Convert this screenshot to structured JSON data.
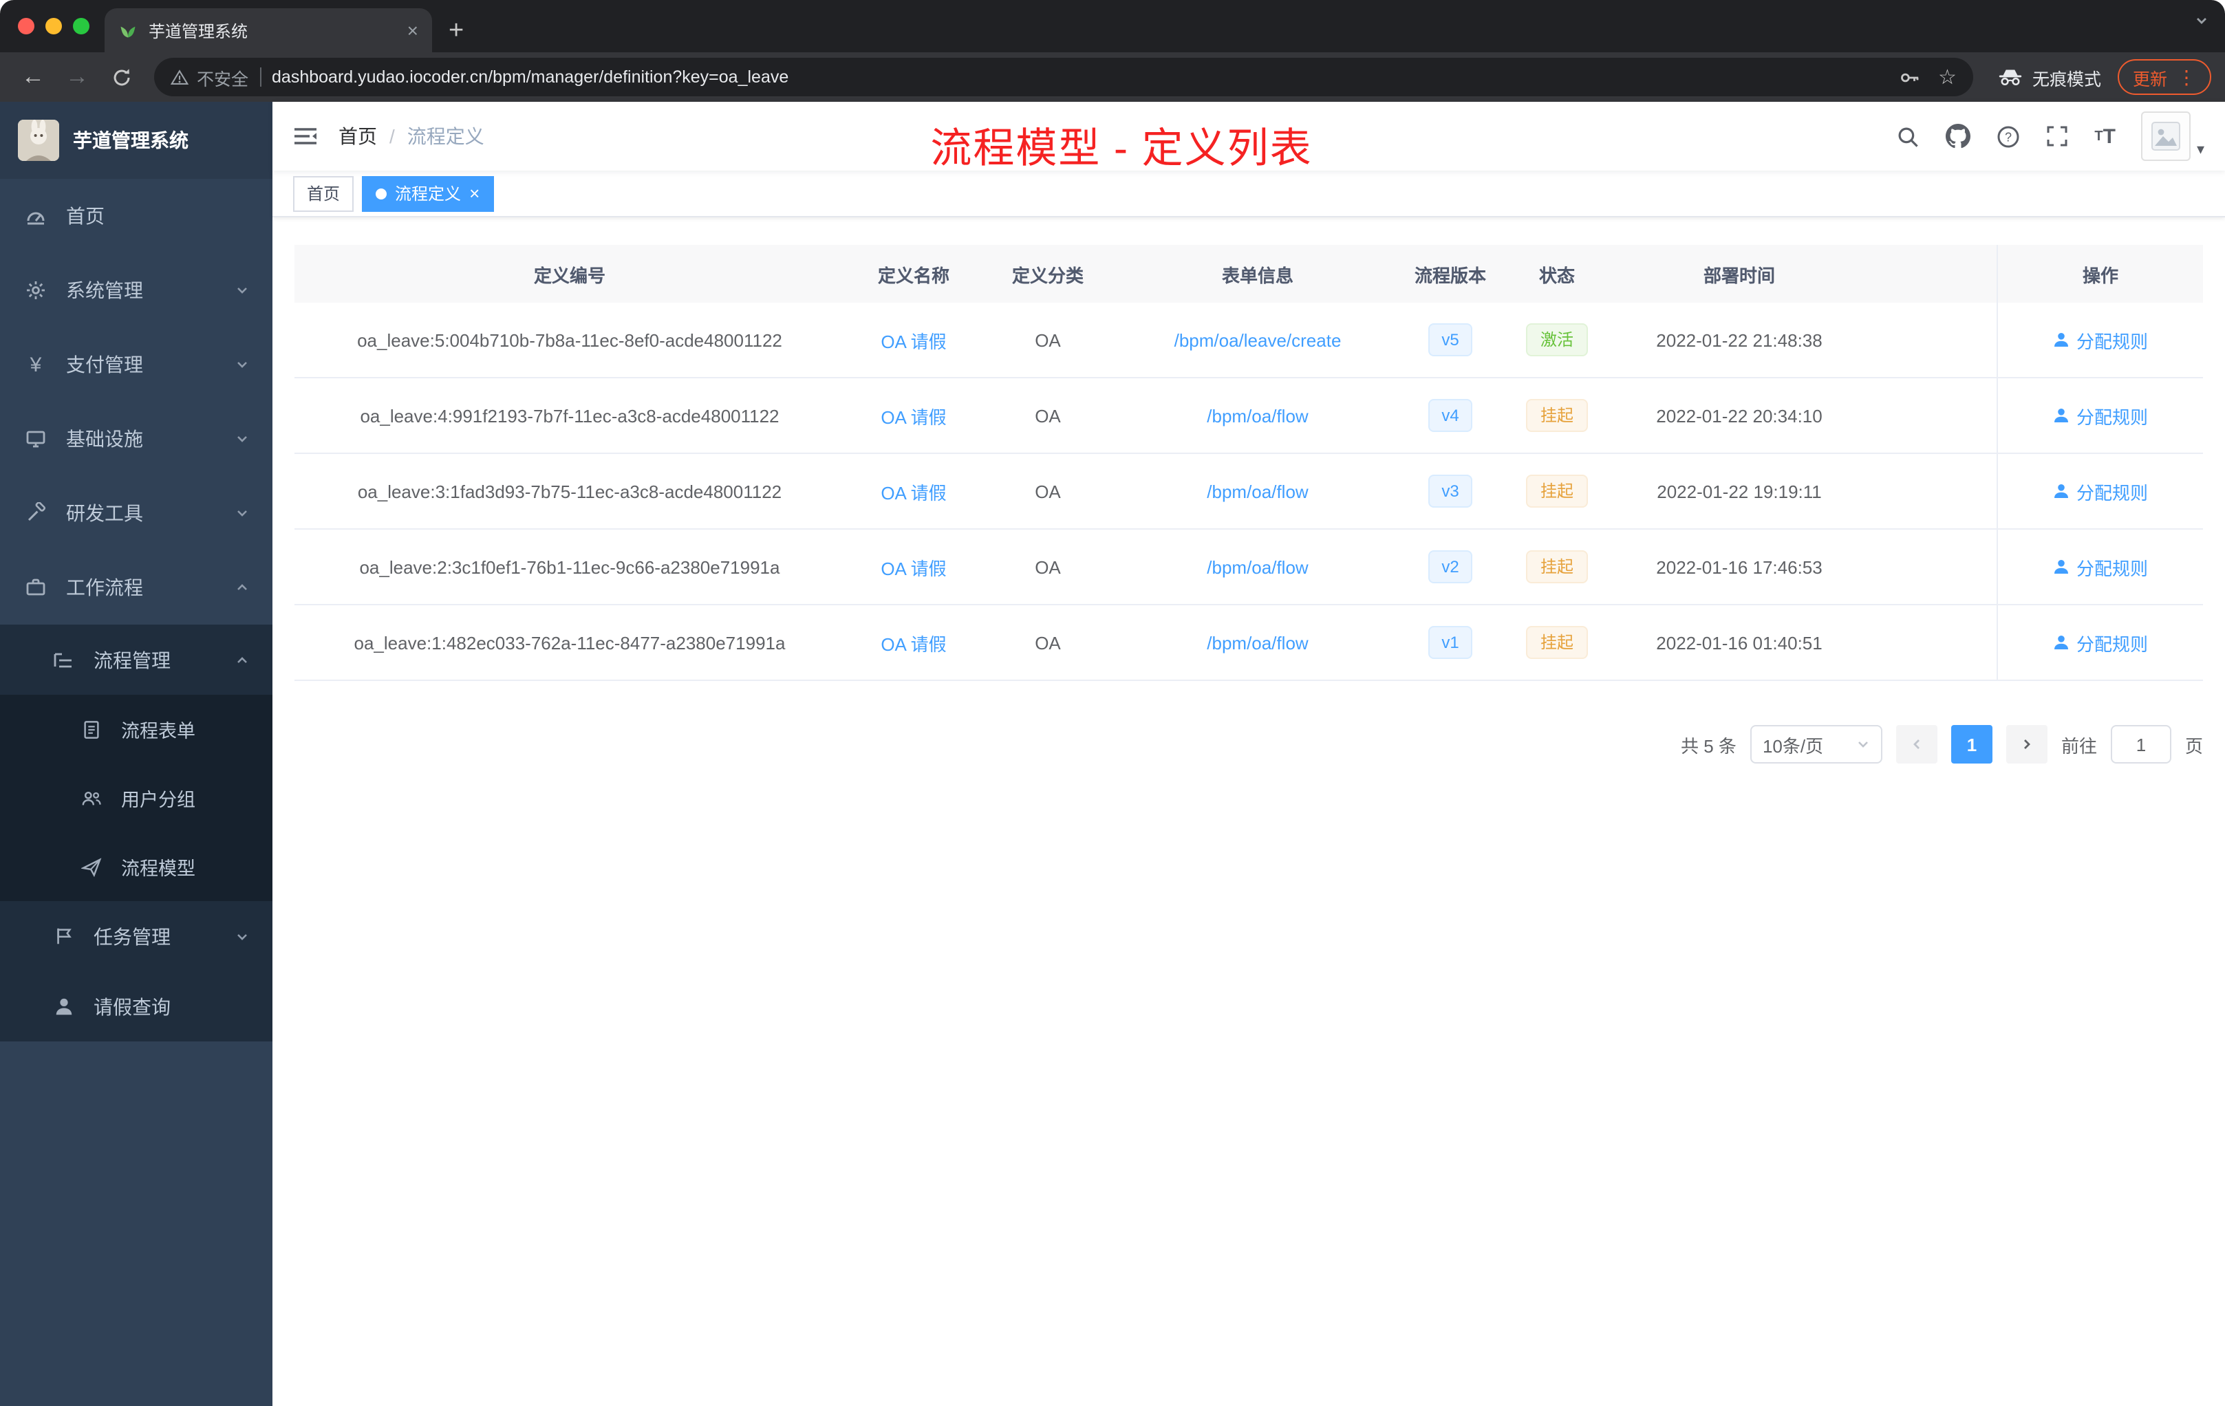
{
  "browser": {
    "tab_title": "芋道管理系统",
    "security_label": "不安全",
    "url": "dashboard.yudao.iocoder.cn/bpm/manager/definition?key=oa_leave",
    "incognito_label": "无痕模式",
    "update_label": "更新"
  },
  "icons": {
    "back": "←",
    "forward": "→",
    "close": "×",
    "new_tab": "+",
    "star": "☆",
    "kebab": "⋮",
    "caret_down": "▾",
    "dot": "",
    "yen": "¥",
    "font_size_letter": "T",
    "breadcrumb_sep": "/"
  },
  "sidebar": {
    "logo_title": "芋道管理系统",
    "items": [
      {
        "label": "首页"
      },
      {
        "label": "系统管理"
      },
      {
        "label": "支付管理"
      },
      {
        "label": "基础设施"
      },
      {
        "label": "研发工具"
      },
      {
        "label": "工作流程",
        "children": [
          {
            "label": "流程管理",
            "children": [
              {
                "label": "流程表单"
              },
              {
                "label": "用户分组"
              },
              {
                "label": "流程模型"
              }
            ]
          },
          {
            "label": "任务管理"
          },
          {
            "label": "请假查询"
          }
        ]
      }
    ]
  },
  "navbar": {
    "breadcrumb": [
      "首页",
      "流程定义"
    ],
    "annotation": "流程模型 - 定义列表"
  },
  "tags": [
    {
      "label": "首页",
      "active": false
    },
    {
      "label": "流程定义",
      "active": true
    }
  ],
  "table": {
    "columns": [
      "定义编号",
      "定义名称",
      "定义分类",
      "表单信息",
      "流程版本",
      "状态",
      "部署时间",
      "操作"
    ],
    "rows": [
      {
        "id": "oa_leave:5:004b710b-7b8a-11ec-8ef0-acde48001122",
        "name": "OA 请假",
        "category": "OA",
        "form": "/bpm/oa/leave/create",
        "version": "v5",
        "status": "激活",
        "status_type": "success",
        "deployed_at": "2022-01-22 21:48:38",
        "action": "分配规则"
      },
      {
        "id": "oa_leave:4:991f2193-7b7f-11ec-a3c8-acde48001122",
        "name": "OA 请假",
        "category": "OA",
        "form": "/bpm/oa/flow",
        "version": "v4",
        "status": "挂起",
        "status_type": "warning",
        "deployed_at": "2022-01-22 20:34:10",
        "action": "分配规则"
      },
      {
        "id": "oa_leave:3:1fad3d93-7b75-11ec-a3c8-acde48001122",
        "name": "OA 请假",
        "category": "OA",
        "form": "/bpm/oa/flow",
        "version": "v3",
        "status": "挂起",
        "status_type": "warning",
        "deployed_at": "2022-01-22 19:19:11",
        "action": "分配规则"
      },
      {
        "id": "oa_leave:2:3c1f0ef1-76b1-11ec-9c66-a2380e71991a",
        "name": "OA 请假",
        "category": "OA",
        "form": "/bpm/oa/flow",
        "version": "v2",
        "status": "挂起",
        "status_type": "warning",
        "deployed_at": "2022-01-16 17:46:53",
        "action": "分配规则"
      },
      {
        "id": "oa_leave:1:482ec033-762a-11ec-8477-a2380e71991a",
        "name": "OA 请假",
        "category": "OA",
        "form": "/bpm/oa/flow",
        "version": "v1",
        "status": "挂起",
        "status_type": "warning",
        "deployed_at": "2022-01-16 01:40:51",
        "action": "分配规则"
      }
    ]
  },
  "pagination": {
    "total": "共 5 条",
    "page_size": "10条/页",
    "page": "1",
    "goto_prefix": "前往",
    "goto_value": "1",
    "goto_suffix": "页"
  },
  "colors": {
    "accent_blue": "#409eff",
    "success_green": "#67c23a",
    "warning_orange": "#e6a23c",
    "sidebar_bg": "#304156",
    "annotation_red": "#f52222",
    "update_orange": "#ee5b2e"
  }
}
